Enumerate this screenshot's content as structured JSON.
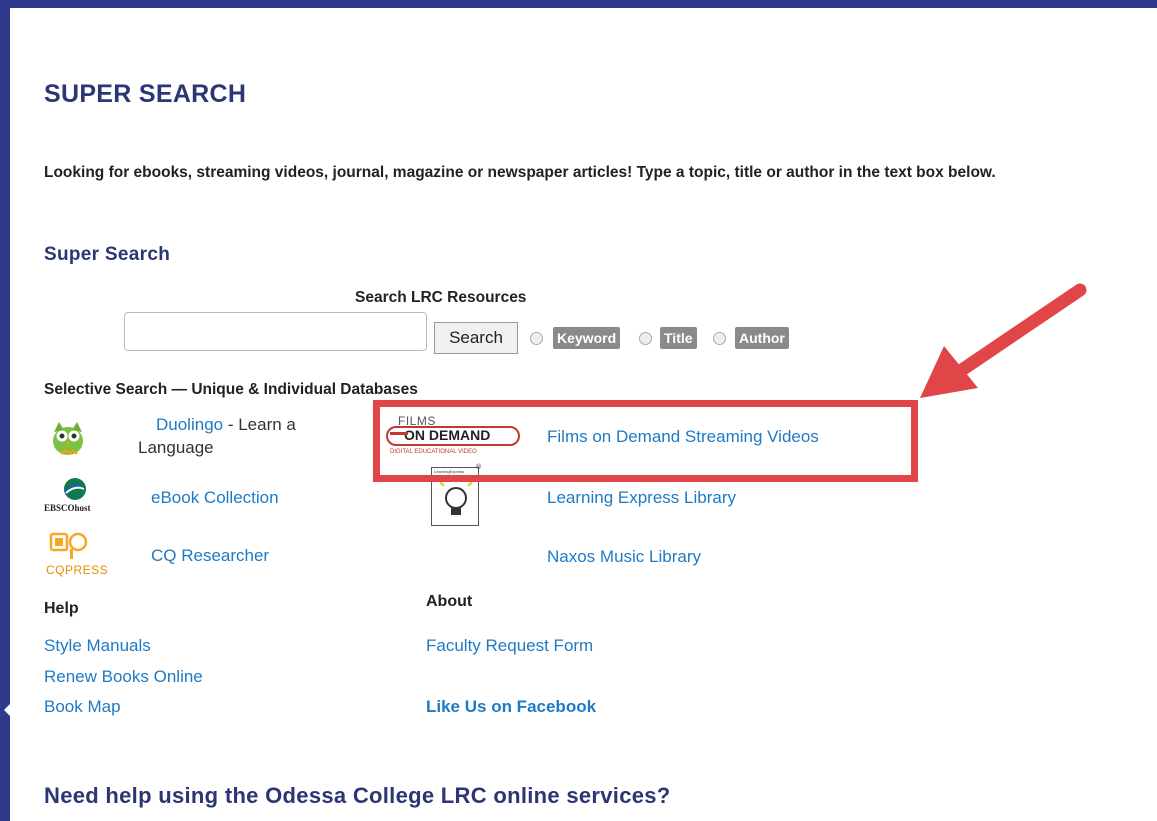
{
  "header": {
    "title": "SUPER SEARCH",
    "intro": "Looking for ebooks, streaming videos, journal, magazine or newspaper articles! Type a topic, title or author in the text box below.",
    "subtitle": "Super Search"
  },
  "search": {
    "label": "Search LRC Resources",
    "input_value": "",
    "button_label": "Search",
    "options": [
      "Keyword",
      "Title",
      "Author"
    ]
  },
  "selective": {
    "title": "Selective Search — Unique & Individual Databases",
    "left": [
      {
        "icon": "duolingo-owl-icon",
        "link": "Duolingo",
        "suffix": " - Learn a",
        "line2": "Language"
      },
      {
        "icon": "ebscohost-logo",
        "logo_text": "EBSCOhost",
        "link": "eBook Collection"
      },
      {
        "icon": "cq-press-logo",
        "logo_text": "CQPRESS",
        "link": "CQ Researcher"
      }
    ],
    "right": [
      {
        "icon": "films-on-demand-logo",
        "logo_top": "FILMS",
        "logo_main": "ON DEMAND",
        "logo_sub": "DIGITAL EDUCATIONAL VIDEO",
        "link": "Films on Demand Streaming Videos"
      },
      {
        "icon": "learning-express-logo",
        "logo_text": "LearningExpress",
        "link": "Learning Express Library"
      },
      {
        "link": "Naxos Music Library"
      }
    ]
  },
  "help": {
    "title": "Help",
    "links": [
      "Style Manuals",
      "Renew Books Online",
      "Book Map"
    ]
  },
  "about": {
    "title": "About",
    "links": [
      "Faculty Request Form"
    ],
    "facebook": "Like Us on Facebook"
  },
  "footer": {
    "heading": "Need help using the Odessa College LRC online services?"
  },
  "colors": {
    "brand": "#2e3a8c",
    "heading": "#2c3675",
    "link": "#1f7ac5",
    "annotation": "#e04648"
  }
}
